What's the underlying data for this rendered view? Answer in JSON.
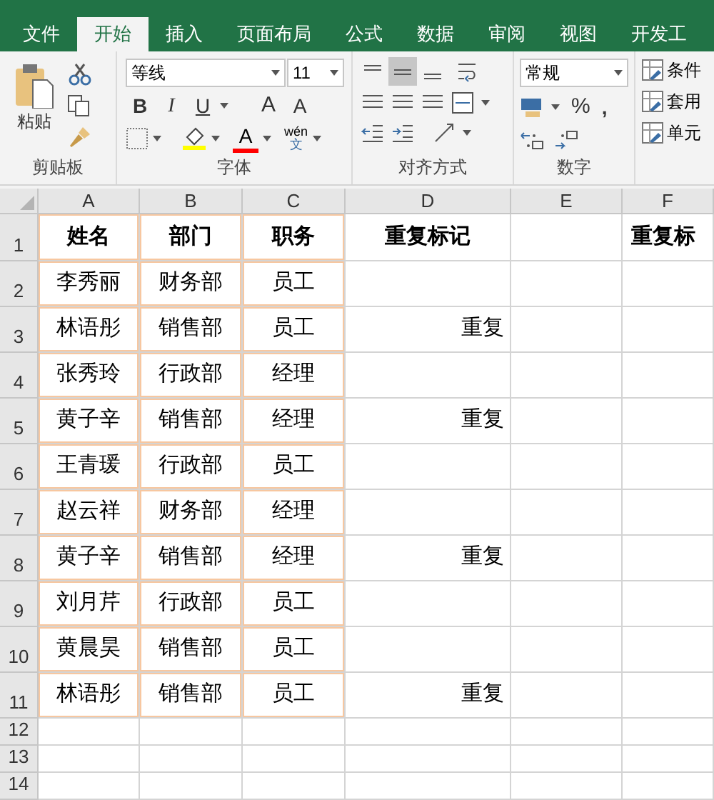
{
  "tabs": [
    {
      "label": "文件",
      "selected": false
    },
    {
      "label": "开始",
      "selected": true
    },
    {
      "label": "插入",
      "selected": false
    },
    {
      "label": "页面布局",
      "selected": false
    },
    {
      "label": "公式",
      "selected": false
    },
    {
      "label": "数据",
      "selected": false
    },
    {
      "label": "审阅",
      "selected": false
    },
    {
      "label": "视图",
      "selected": false
    },
    {
      "label": "开发工",
      "selected": false
    }
  ],
  "ribbon": {
    "clipboard": {
      "paste": "粘贴",
      "label": "剪贴板"
    },
    "font": {
      "name": "等线",
      "size": "11",
      "bold": "B",
      "italic": "I",
      "underline": "U",
      "grow": "A",
      "shrink": "A",
      "font_color": "A",
      "phonetic": "wén",
      "phonetic_char": "文",
      "label": "字体"
    },
    "alignment": {
      "vertical": [
        {
          "selected": false
        },
        {
          "selected": true
        },
        {
          "selected": false
        }
      ],
      "label": "对齐方式"
    },
    "number": {
      "format": "常规",
      "percent": "%",
      "comma": ",",
      "label": "数字"
    },
    "styles": {
      "items": [
        "条件",
        "套用",
        "单元"
      ]
    }
  },
  "sheet": {
    "columns": [
      "A",
      "B",
      "C",
      "D",
      "E",
      "F"
    ],
    "rows": [
      {
        "number": "1",
        "cells": [
          "姓名",
          "部门",
          "职务",
          "重复标记",
          "",
          "重复标"
        ]
      },
      {
        "number": "2",
        "cells": [
          "李秀丽",
          "财务部",
          "员工",
          "",
          "",
          ""
        ]
      },
      {
        "number": "3",
        "cells": [
          "林语彤",
          "销售部",
          "员工",
          "重复",
          "",
          ""
        ]
      },
      {
        "number": "4",
        "cells": [
          "张秀玲",
          "行政部",
          "经理",
          "",
          "",
          ""
        ]
      },
      {
        "number": "5",
        "cells": [
          "黄子辛",
          "销售部",
          "经理",
          "重复",
          "",
          ""
        ]
      },
      {
        "number": "6",
        "cells": [
          "王青瑗",
          "行政部",
          "员工",
          "",
          "",
          ""
        ]
      },
      {
        "number": "7",
        "cells": [
          "赵云祥",
          "财务部",
          "经理",
          "",
          "",
          ""
        ]
      },
      {
        "number": "8",
        "cells": [
          "黄子辛",
          "销售部",
          "经理",
          "重复",
          "",
          ""
        ]
      },
      {
        "number": "9",
        "cells": [
          "刘月芹",
          "行政部",
          "员工",
          "",
          "",
          ""
        ]
      },
      {
        "number": "10",
        "cells": [
          "黄晨昊",
          "销售部",
          "员工",
          "",
          "",
          ""
        ]
      },
      {
        "number": "11",
        "cells": [
          "林语彤",
          "销售部",
          "员工",
          "重复",
          "",
          ""
        ]
      },
      {
        "number": "12",
        "cells": [
          "",
          "",
          "",
          "",
          "",
          ""
        ]
      },
      {
        "number": "13",
        "cells": [
          "",
          "",
          "",
          "",
          "",
          ""
        ]
      },
      {
        "number": "14",
        "cells": [
          "",
          "",
          "",
          "",
          "",
          ""
        ]
      }
    ]
  }
}
